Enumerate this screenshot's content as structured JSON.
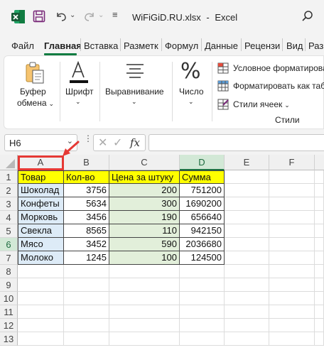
{
  "titlebar": {
    "filename": "WiFiGiD.RU.xlsx",
    "separator": "-",
    "app_name": "Excel",
    "brand_color": "#1D6F42"
  },
  "menu": {
    "tabs": [
      "Файл",
      "Главная",
      "Вставка",
      "Разметк",
      "Формул",
      "Данные",
      "Рецензи",
      "Вид",
      "Раз"
    ]
  },
  "ribbon": {
    "clipboard_label_1": "Буфер",
    "clipboard_label_2": "обмена",
    "font_label": "Шрифт",
    "alignment_label": "Выравнивание",
    "number_label": "Число",
    "conditional_format": "Условное форматирова",
    "format_as_table": "Форматировать как табл",
    "cell_styles": "Стили ячеек",
    "styles_group": "Стили"
  },
  "formula_bar": {
    "name_box": "H6",
    "fx": "fx",
    "formula": ""
  },
  "sheet": {
    "columns": [
      "A",
      "B",
      "C",
      "D",
      "E",
      "F"
    ],
    "rows": [
      "1",
      "2",
      "3",
      "4",
      "5",
      "6",
      "7",
      "8",
      "9",
      "10",
      "11",
      "12",
      "13"
    ],
    "headers": [
      "Товар",
      "Кол-во",
      "Цена за штуку",
      "Сумма"
    ],
    "data": [
      [
        "Шоколад",
        "3756",
        "200",
        "751200"
      ],
      [
        "Конфеты",
        "5634",
        "300",
        "1690200"
      ],
      [
        "Морковь",
        "3456",
        "190",
        "656640"
      ],
      [
        "Свекла",
        "8565",
        "110",
        "942150"
      ],
      [
        "Мясо",
        "3452",
        "590",
        "2036680"
      ],
      [
        "Молоко",
        "1245",
        "100",
        "124500"
      ]
    ],
    "highlight_color": "#e53935"
  }
}
